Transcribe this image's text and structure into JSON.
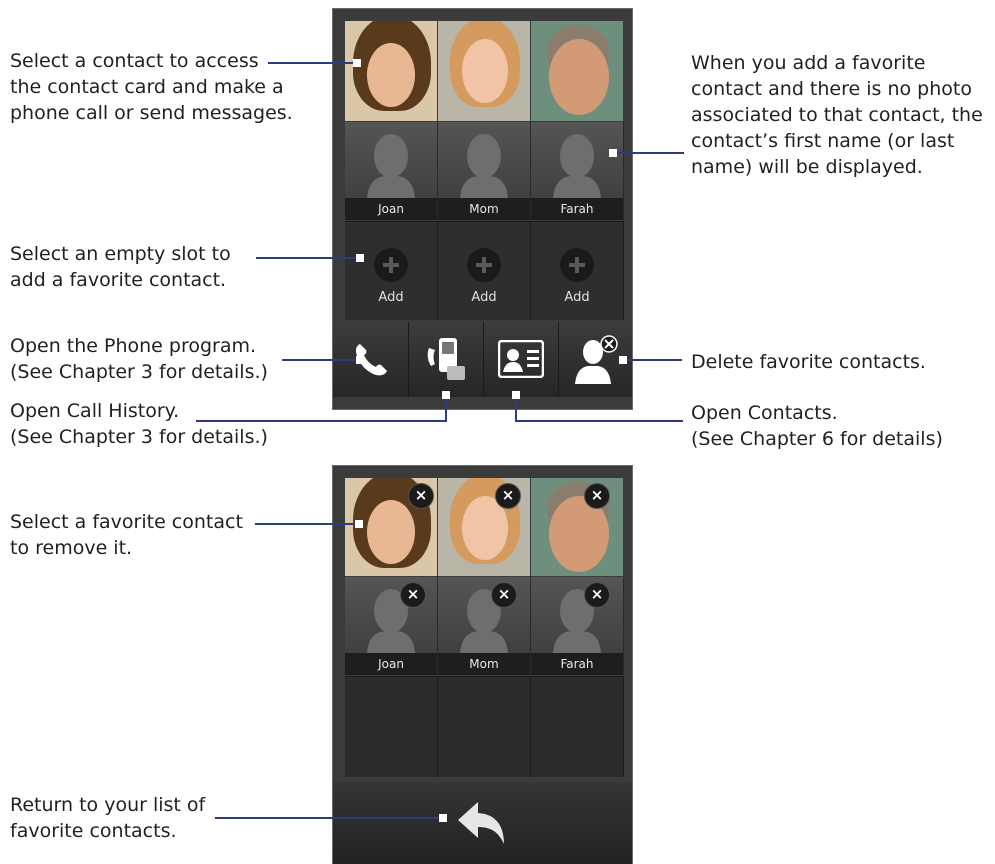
{
  "callouts": {
    "select_contact": "Select a contact to access\nthe contact card and make a\nphone call or send messages.",
    "no_photo": "When you add a favorite\ncontact and there is no photo\nassociated to that contact, the\ncontact’s first name (or last\nname) will be displayed.",
    "empty_slot": "Select an empty slot to\nadd a favorite contact.",
    "open_phone": "Open the Phone program.\n(See Chapter 3 for details.)",
    "delete_favorites": "Delete favorite contacts.",
    "call_history": "Open Call History.\n(See Chapter 3 for details.)",
    "open_contacts": "Open Contacts.\n(See Chapter 6 for details)",
    "remove_favorite": "Select a favorite contact\nto remove it.",
    "return_list": "Return to your list of\nfavorite contacts."
  },
  "screen1": {
    "named_contacts": [
      "Joan",
      "Mom",
      "Farah"
    ],
    "add_labels": [
      "Add",
      "Add",
      "Add"
    ]
  },
  "screen2": {
    "named_contacts": [
      "Joan",
      "Mom",
      "Farah"
    ],
    "remove_glyph": "×"
  },
  "colors": {
    "leader_line": "#2f3a80",
    "phone_bg": "#3b3b3b"
  }
}
